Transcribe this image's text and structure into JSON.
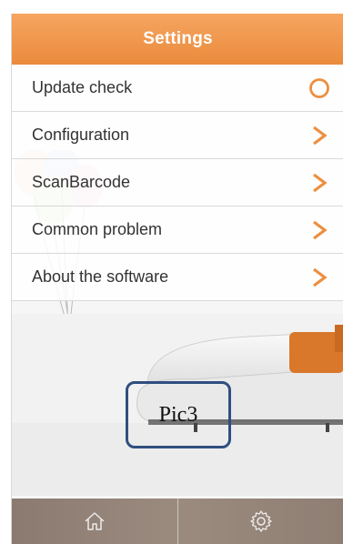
{
  "header": {
    "title": "Settings"
  },
  "menu": {
    "items": [
      {
        "label": "Update check",
        "icon": "circle-icon"
      },
      {
        "label": "Configuration",
        "icon": "chevron-right-icon"
      },
      {
        "label": "ScanBarcode",
        "icon": "chevron-right-icon"
      },
      {
        "label": "Common problem",
        "icon": "chevron-right-icon"
      },
      {
        "label": "About the software",
        "icon": "chevron-right-icon"
      }
    ]
  },
  "callout": {
    "text": "Pic3"
  },
  "bottom_bar": {
    "items": [
      {
        "icon": "home-icon"
      },
      {
        "icon": "gear-icon"
      }
    ]
  },
  "colors": {
    "accent": "#ec8f40",
    "bottom_bar": "#8f7f74",
    "callout_border": "#2f4f7f"
  }
}
